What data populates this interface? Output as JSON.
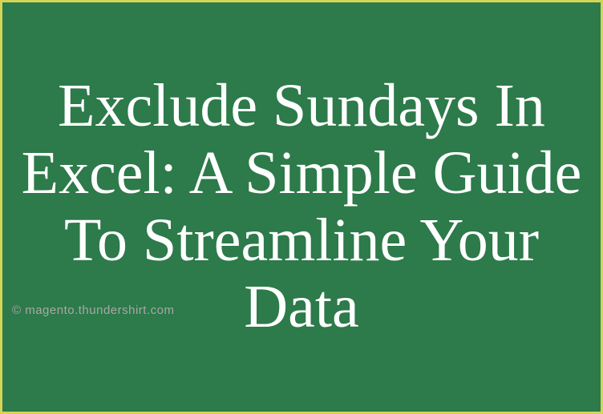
{
  "banner": {
    "title": "Exclude Sundays In Excel: A Simple Guide To Streamline Your Data",
    "watermark": "© magento.thundershirt.com"
  },
  "colors": {
    "background": "#2d7a4a",
    "border": "#d4d456",
    "text": "#ffffff",
    "watermark": "#a8a8a8"
  }
}
